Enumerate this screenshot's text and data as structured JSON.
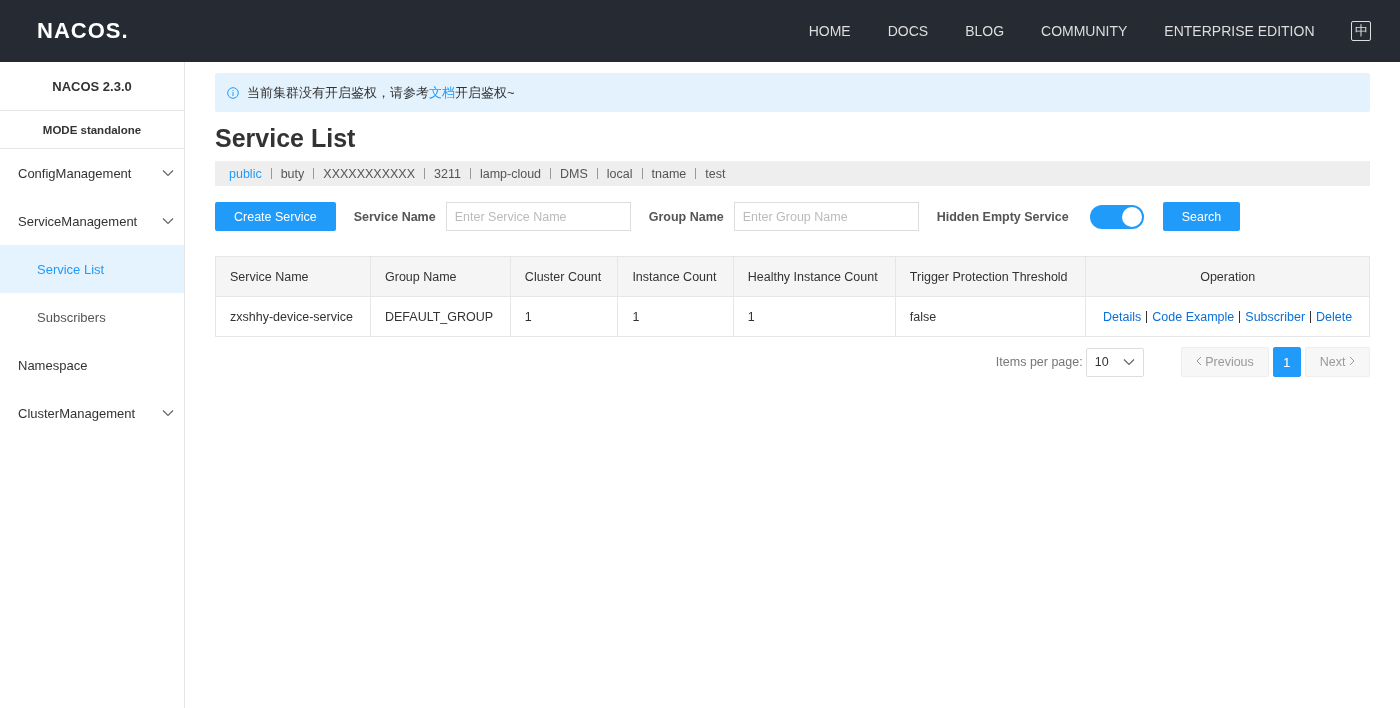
{
  "header": {
    "logo": "NACOS.",
    "nav": [
      {
        "label": "HOME"
      },
      {
        "label": "DOCS"
      },
      {
        "label": "BLOG"
      },
      {
        "label": "COMMUNITY"
      },
      {
        "label": "ENTERPRISE EDITION"
      }
    ],
    "language_button": "中"
  },
  "sidebar": {
    "version": "NACOS 2.3.0",
    "mode": "MODE standalone",
    "items": [
      {
        "label": "ConfigManagement",
        "expandable": true,
        "selected": false
      },
      {
        "label": "ServiceManagement",
        "expandable": true,
        "selected": false,
        "children": [
          {
            "label": "Service List",
            "selected": true
          },
          {
            "label": "Subscribers",
            "selected": false
          }
        ]
      },
      {
        "label": "Namespace",
        "expandable": false,
        "selected": false
      },
      {
        "label": "ClusterManagement",
        "expandable": true,
        "selected": false
      }
    ]
  },
  "notice": {
    "before": "当前集群没有开启鉴权，请参考",
    "link": "文档",
    "after": "开启鉴权~"
  },
  "title": "Service List",
  "namespaces": [
    {
      "label": "public",
      "selected": true
    },
    {
      "label": "buty",
      "selected": false
    },
    {
      "label": "XXXXXXXXXXX",
      "selected": false
    },
    {
      "label": "3211",
      "selected": false
    },
    {
      "label": "lamp-cloud",
      "selected": false
    },
    {
      "label": "DMS",
      "selected": false
    },
    {
      "label": "local",
      "selected": false
    },
    {
      "label": "tname",
      "selected": false
    },
    {
      "label": "test",
      "selected": false
    }
  ],
  "toolbar": {
    "create_button": "Create Service",
    "service_name_label": "Service Name",
    "service_name_placeholder": "Enter Service Name",
    "group_name_label": "Group Name",
    "group_name_placeholder": "Enter Group Name",
    "hidden_empty_label": "Hidden Empty Service",
    "hidden_empty_on": true,
    "search_button": "Search"
  },
  "table": {
    "columns": [
      "Service Name",
      "Group Name",
      "Cluster Count",
      "Instance Count",
      "Healthy Instance Count",
      "Trigger Protection Threshold",
      "Operation"
    ],
    "rows": [
      {
        "cells": [
          "zxshhy-device-service",
          "DEFAULT_GROUP",
          "1",
          "1",
          "1",
          "false"
        ],
        "operations": [
          "Details",
          "Code Example",
          "Subscriber",
          "Delete"
        ]
      }
    ]
  },
  "pagination": {
    "items_per_page_label": "Items per page:",
    "page_size": "10",
    "previous": {
      "label": "Previous",
      "disabled": true
    },
    "pages": [
      {
        "label": "1",
        "selected": true
      }
    ],
    "next": {
      "label": "Next",
      "disabled": true
    }
  }
}
